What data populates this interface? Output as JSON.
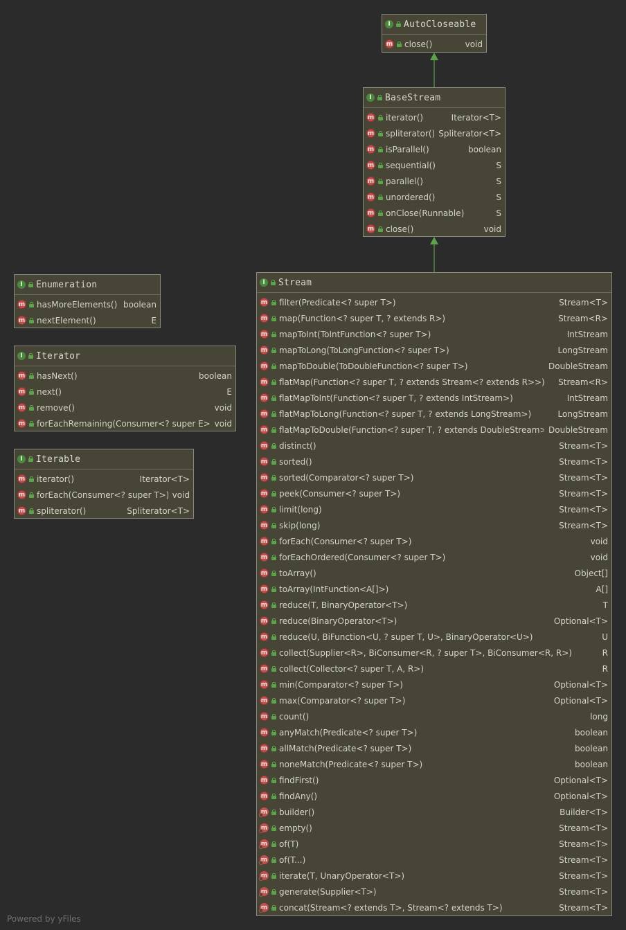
{
  "classes": {
    "autocloseable": {
      "name": "AutoCloseable",
      "methods": [
        {
          "name": "close()",
          "ret": "void"
        }
      ]
    },
    "basestream": {
      "name": "BaseStream",
      "methods": [
        {
          "name": "iterator()",
          "ret": "Iterator<T>"
        },
        {
          "name": "spliterator()",
          "ret": "Spliterator<T>"
        },
        {
          "name": "isParallel()",
          "ret": "boolean"
        },
        {
          "name": "sequential()",
          "ret": "S"
        },
        {
          "name": "parallel()",
          "ret": "S"
        },
        {
          "name": "unordered()",
          "ret": "S"
        },
        {
          "name": "onClose(Runnable)",
          "ret": "S"
        },
        {
          "name": "close()",
          "ret": "void"
        }
      ]
    },
    "enumeration": {
      "name": "Enumeration",
      "methods": [
        {
          "name": "hasMoreElements()",
          "ret": "boolean"
        },
        {
          "name": "nextElement()",
          "ret": "E"
        }
      ]
    },
    "iterator": {
      "name": "Iterator",
      "methods": [
        {
          "name": "hasNext()",
          "ret": "boolean"
        },
        {
          "name": "next()",
          "ret": "E"
        },
        {
          "name": "remove()",
          "ret": "void"
        },
        {
          "name": "forEachRemaining(Consumer<? super E>)",
          "ret": "void"
        }
      ]
    },
    "iterable": {
      "name": "Iterable",
      "methods": [
        {
          "name": "iterator()",
          "ret": "Iterator<T>"
        },
        {
          "name": "forEach(Consumer<? super T>)",
          "ret": "void"
        },
        {
          "name": "spliterator()",
          "ret": "Spliterator<T>"
        }
      ]
    },
    "stream": {
      "name": "Stream",
      "methods": [
        {
          "name": "filter(Predicate<? super T>)",
          "ret": "Stream<T>"
        },
        {
          "name": "map(Function<? super T, ? extends R>)",
          "ret": "Stream<R>"
        },
        {
          "name": "mapToInt(ToIntFunction<? super T>)",
          "ret": "IntStream"
        },
        {
          "name": "mapToLong(ToLongFunction<? super T>)",
          "ret": "LongStream"
        },
        {
          "name": "mapToDouble(ToDoubleFunction<? super T>)",
          "ret": "DoubleStream"
        },
        {
          "name": "flatMap(Function<? super T, ? extends Stream<? extends R>>)",
          "ret": "Stream<R>"
        },
        {
          "name": "flatMapToInt(Function<? super T, ? extends IntStream>)",
          "ret": "IntStream"
        },
        {
          "name": "flatMapToLong(Function<? super T, ? extends LongStream>)",
          "ret": "LongStream"
        },
        {
          "name": "flatMapToDouble(Function<? super T, ? extends DoubleStream>)",
          "ret": "DoubleStream"
        },
        {
          "name": "distinct()",
          "ret": "Stream<T>"
        },
        {
          "name": "sorted()",
          "ret": "Stream<T>"
        },
        {
          "name": "sorted(Comparator<? super T>)",
          "ret": "Stream<T>"
        },
        {
          "name": "peek(Consumer<? super T>)",
          "ret": "Stream<T>"
        },
        {
          "name": "limit(long)",
          "ret": "Stream<T>"
        },
        {
          "name": "skip(long)",
          "ret": "Stream<T>"
        },
        {
          "name": "forEach(Consumer<? super T>)",
          "ret": "void"
        },
        {
          "name": "forEachOrdered(Consumer<? super T>)",
          "ret": "void"
        },
        {
          "name": "toArray()",
          "ret": "Object[]"
        },
        {
          "name": "toArray(IntFunction<A[]>)",
          "ret": "A[]"
        },
        {
          "name": "reduce(T, BinaryOperator<T>)",
          "ret": "T"
        },
        {
          "name": "reduce(BinaryOperator<T>)",
          "ret": "Optional<T>"
        },
        {
          "name": "reduce(U, BiFunction<U, ? super T, U>, BinaryOperator<U>)",
          "ret": "U"
        },
        {
          "name": "collect(Supplier<R>, BiConsumer<R, ? super T>, BiConsumer<R, R>)",
          "ret": "R"
        },
        {
          "name": "collect(Collector<? super T, A, R>)",
          "ret": "R"
        },
        {
          "name": "min(Comparator<? super T>)",
          "ret": "Optional<T>"
        },
        {
          "name": "max(Comparator<? super T>)",
          "ret": "Optional<T>"
        },
        {
          "name": "count()",
          "ret": "long"
        },
        {
          "name": "anyMatch(Predicate<? super T>)",
          "ret": "boolean"
        },
        {
          "name": "allMatch(Predicate<? super T>)",
          "ret": "boolean"
        },
        {
          "name": "noneMatch(Predicate<? super T>)",
          "ret": "boolean"
        },
        {
          "name": "findFirst()",
          "ret": "Optional<T>"
        },
        {
          "name": "findAny()",
          "ret": "Optional<T>"
        },
        {
          "name": "builder()",
          "ret": "Builder<T>"
        },
        {
          "name": "empty()",
          "ret": "Stream<T>"
        },
        {
          "name": "of(T)",
          "ret": "Stream<T>"
        },
        {
          "name": "of(T...)",
          "ret": "Stream<T>"
        },
        {
          "name": "iterate(T, UnaryOperator<T>)",
          "ret": "Stream<T>"
        },
        {
          "name": "generate(Supplier<T>)",
          "ret": "Stream<T>"
        },
        {
          "name": "concat(Stream<? extends T>, Stream<? extends T>)",
          "ret": "Stream<T>"
        }
      ]
    }
  },
  "icons": {
    "interface": "I",
    "method": "m"
  },
  "colors": {
    "background": "#2b2b2b",
    "node": "#474535",
    "arrow": "#5da34b",
    "method_icon": "#c0504d",
    "interface_icon": "#4b8a3e"
  },
  "footer": "Powered by yFiles"
}
